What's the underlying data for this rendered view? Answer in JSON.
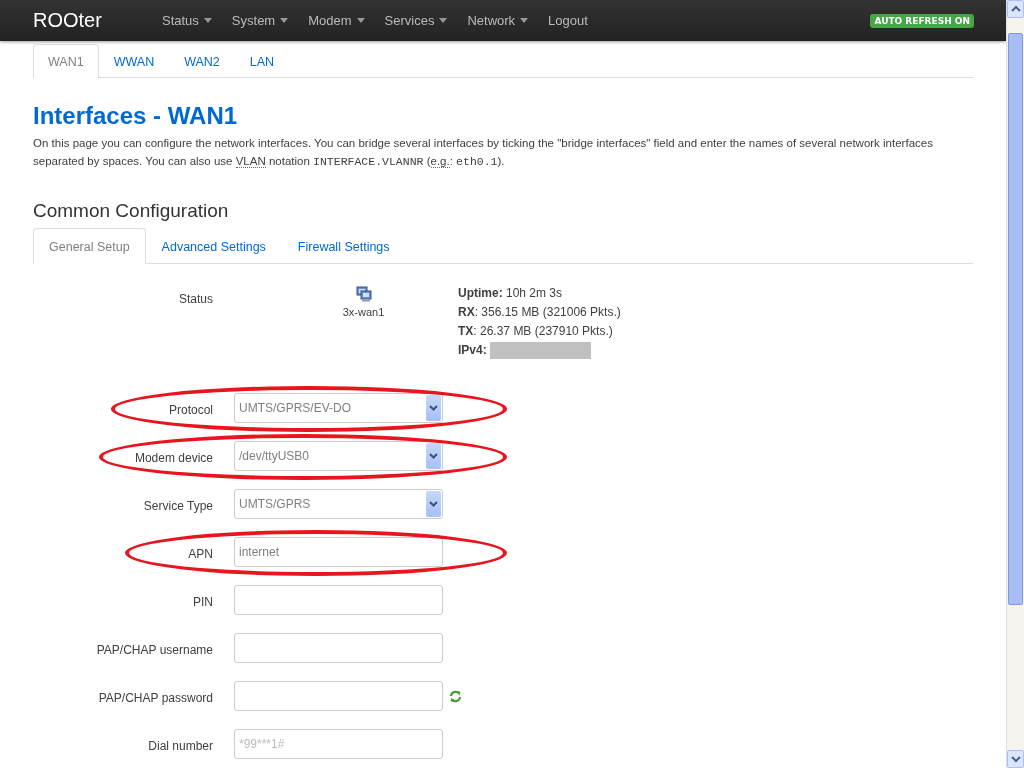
{
  "navbar": {
    "brand": "ROOter",
    "menu": [
      {
        "label": "Status",
        "dropdown": true
      },
      {
        "label": "System",
        "dropdown": true
      },
      {
        "label": "Modem",
        "dropdown": true
      },
      {
        "label": "Services",
        "dropdown": true
      },
      {
        "label": "Network",
        "dropdown": true
      },
      {
        "label": "Logout",
        "dropdown": false
      }
    ],
    "badge": "AUTO REFRESH ON"
  },
  "tabs": [
    {
      "label": "WAN1",
      "selected": true
    },
    {
      "label": "WWAN",
      "selected": false
    },
    {
      "label": "WAN2",
      "selected": false
    },
    {
      "label": "LAN",
      "selected": false
    }
  ],
  "title": "Interfaces - WAN1",
  "description": [
    {
      "kind": "text",
      "text": "On this page you can configure the network interfaces. You can bridge several interfaces by ticking the \"bridge interfaces\" field and enter the names of several network interfaces separated by spaces. You can also use "
    },
    {
      "kind": "abbr",
      "text": "VLAN"
    },
    {
      "kind": "text",
      "text": " notation "
    },
    {
      "kind": "code",
      "text": "INTERFACE.VLANNR"
    },
    {
      "kind": "text",
      "text": " ("
    },
    {
      "kind": "abbr",
      "text": "e.g."
    },
    {
      "kind": "text",
      "text": ": "
    },
    {
      "kind": "code",
      "text": "eth0.1"
    },
    {
      "kind": "text",
      "text": ")."
    }
  ],
  "section_title": "Common Configuration",
  "subtabs": [
    {
      "label": "General Setup",
      "selected": true
    },
    {
      "label": "Advanced Settings",
      "selected": false
    },
    {
      "label": "Firewall Settings",
      "selected": false
    }
  ],
  "status": {
    "label": "Status",
    "device": "3x-wan1",
    "lines": [
      {
        "key": "Uptime:",
        "value": " 10h 2m 3s"
      },
      {
        "key": "RX",
        "value": ": 356.15 MB (321006 Pkts.)"
      },
      {
        "key": "TX",
        "value": ": 26.37 MB (237910 Pkts.)"
      },
      {
        "key": "IPv4:"
      }
    ]
  },
  "fields": [
    {
      "label": "Protocol",
      "kind": "select",
      "value": "UMTS/GPRS/EV-DO",
      "highlighted": true
    },
    {
      "label": "Modem device",
      "kind": "select",
      "value": "/dev/ttyUSB0",
      "highlighted": true
    },
    {
      "label": "Service Type",
      "kind": "select",
      "value": "UMTS/GPRS",
      "highlighted": false
    },
    {
      "label": "APN",
      "kind": "text",
      "value": "internet",
      "highlighted": true
    },
    {
      "label": "PIN",
      "kind": "text",
      "highlighted": false
    },
    {
      "label": "PAP/CHAP username",
      "kind": "text",
      "highlighted": false
    },
    {
      "label": "PAP/CHAP password",
      "kind": "password",
      "highlighted": false
    },
    {
      "label": "Dial number",
      "kind": "text",
      "placeholder": "*99***1#",
      "highlighted": false
    }
  ]
}
